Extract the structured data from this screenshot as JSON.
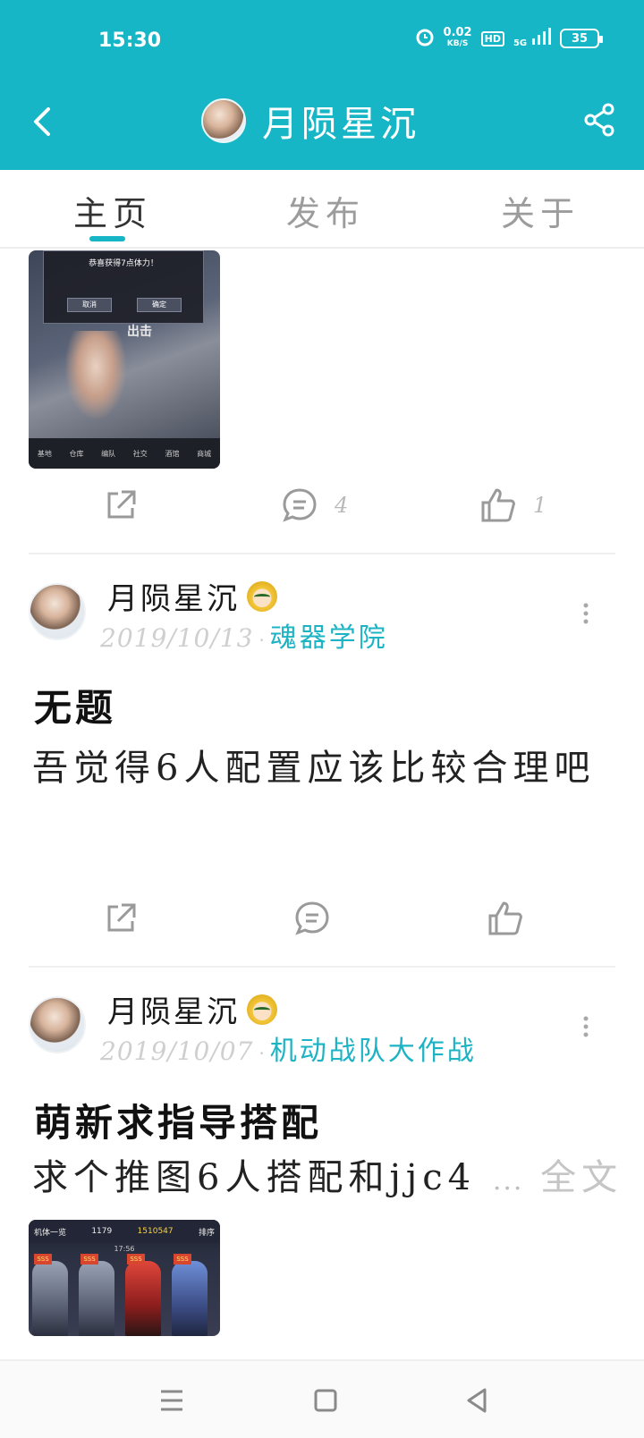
{
  "status_bar": {
    "time": "15:30",
    "net_speed_value": "0.02",
    "net_speed_unit": "KB/S",
    "hd_badge": "HD",
    "signal_label": "5G",
    "battery": "35"
  },
  "header": {
    "title": "月陨星沉",
    "accent_color": "#17b6c6"
  },
  "tabs": [
    {
      "label": "主页",
      "active": true
    },
    {
      "label": "发布",
      "active": false
    },
    {
      "label": "关于",
      "active": false
    }
  ],
  "post0": {
    "image": {
      "dialog_title": "恭喜获得7点体力！",
      "cancel_label": "取消",
      "confirm_label": "确定",
      "battle_label": "出击",
      "tabbar": [
        "基地",
        "仓库",
        "编队",
        "社交",
        "酒馆",
        "商城"
      ]
    },
    "comment_count": "4",
    "like_count": "1"
  },
  "post1": {
    "author": "月陨星沉",
    "date": "2019/10/13",
    "separator": "·",
    "circle": "魂器学院",
    "title": "无题",
    "body": "吾觉得6人配置应该比较合理吧"
  },
  "post2": {
    "author": "月陨星沉",
    "date": "2019/10/07",
    "separator": "·",
    "circle": "机动战队大作战",
    "title": "萌新求指导搭配",
    "body": "求个推图6人搭配和jjc4",
    "ellipsis": "...",
    "read_more": "全文",
    "image": {
      "header_label": "机体一览",
      "count_a": "1179",
      "count_b": "1510547",
      "sort_label": "排序",
      "timer": "17:56",
      "rank_tag": "SSS"
    }
  }
}
